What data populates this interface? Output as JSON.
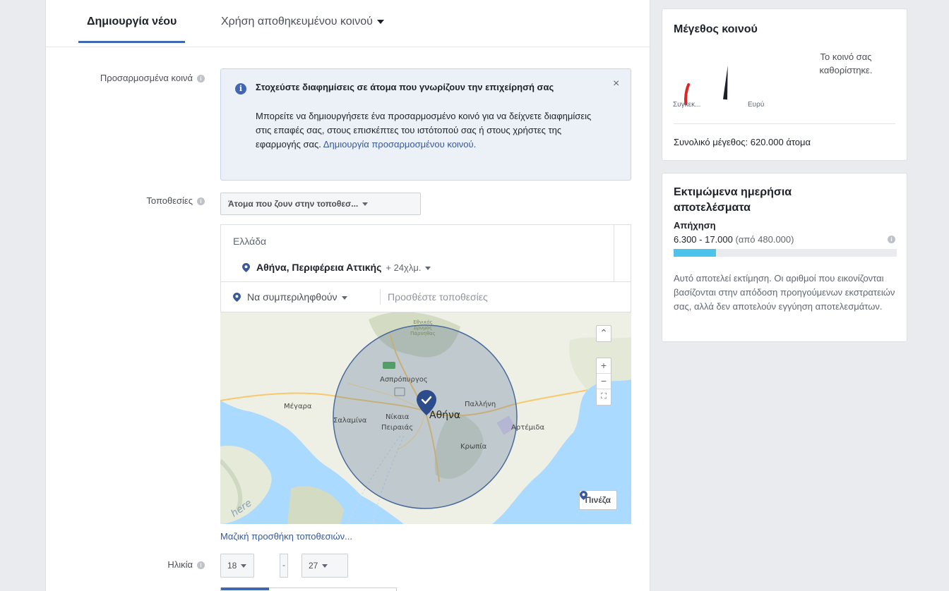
{
  "tabs": {
    "create_new": "Δημιουργία νέου",
    "use_saved": "Χρήση αποθηκευμένου κοινού"
  },
  "custom_audiences": {
    "label": "Προσαρμοσμένα κοινά",
    "info_title": "Στοχεύστε διαφημίσεις σε άτομα που γνωρίζουν την επιχείρησή σας",
    "info_body": "Μπορείτε να δημιουργήσετε ένα προσαρμοσμένο κοινό για να δείχνετε διαφημίσεις στις επαφές σας, στους επισκέπτες του ιστότοπού σας ή στους χρήστες της εφαρμογής σας.",
    "info_link": "Δημιουργία προσαρμοσμένου κοινού.",
    "close": "×"
  },
  "locations": {
    "label": "Τοποθεσίες",
    "type_select": "Άτομα που ζουν στην τοποθεσ...",
    "country": "Ελλάδα",
    "city": "Αθήνα, Περιφέρεια Αττικής",
    "radius": "+ 24χλμ.",
    "include_select": "Να συμπεριληφθούν",
    "add_placeholder": "Προσθέστε τοποθεσίες",
    "bulk_link": "Μαζική προσθήκη τοποθεσιών...",
    "drop_pin": "Πινέζα"
  },
  "map": {
    "labels": {
      "athina": "Αθήνα",
      "megara": "Μέγαρα",
      "pallini": "Παλλήνη",
      "aspropyrgos": "Ασπρόπυργος",
      "nikaia": "Νίκαια",
      "peiraias": "Πειραιάς",
      "kropia": "Κρωπία",
      "artemida": "Αρτέμιδα",
      "salamina": "Σαλαμίνα",
      "national_forest": "Εθνικός Δρυμός Πάρνηθας",
      "watermark": "here"
    },
    "zoom_in": "+",
    "zoom_out": "−",
    "scroll_up": "⌃",
    "fullscreen": "⛶"
  },
  "age": {
    "label": "Ηλικία",
    "min": "18",
    "max": "27",
    "separator": "-"
  },
  "audience_size": {
    "title": "Μέγεθος κοινού",
    "note": "Το κοινό σας καθορίστηκε.",
    "specific": "Συγκεκ...",
    "broad": "Ευρύ",
    "total": "Συνολικό μέγεθος: 620.000 άτομα",
    "gauge_value": 0.52
  },
  "daily_results": {
    "title": "Εκτιμώμενα ημερήσια αποτελέσματα",
    "reach_label": "Απήχηση",
    "reach_range": "6.300 - 17.000",
    "reach_of": "(από 480.000)",
    "reach_fraction": 0.19,
    "disclaimer": "Αυτό αποτελεί εκτίμηση. Οι αριθμοί που εικονίζονται βασίζονται στην απόδοση προηγούμενων εκστρατειών σας, αλλά δεν αποτελούν εγγύηση αποτελεσμάτων."
  },
  "colors": {
    "accent": "#4267b2",
    "link": "#365899",
    "reach_bar": "#4cc3ea",
    "gauge_green": "#42b72a",
    "gauge_red": "#e02424",
    "gauge_orange": "#f7b267"
  }
}
